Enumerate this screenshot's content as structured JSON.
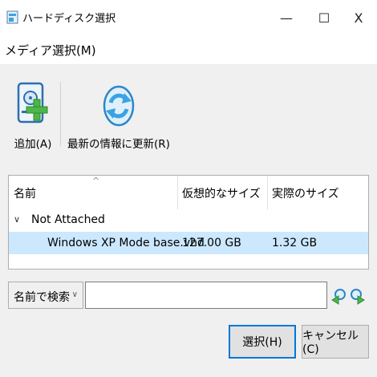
{
  "window": {
    "title": "ハードディスク選択",
    "minimize_glyph": "—",
    "maximize_glyph": "☐",
    "close_glyph": "X"
  },
  "menu": {
    "media_label": "メディア選択(M)"
  },
  "toolbar": {
    "add_label": "追加(A)",
    "add_icon": "hard-disk-add-icon",
    "refresh_label": "最新の情報に更新(R)",
    "refresh_icon": "refresh-icon"
  },
  "list": {
    "columns": [
      "名前",
      "仮想的なサイズ",
      "実際のサイズ"
    ],
    "sort_indicator": "^",
    "groups": [
      {
        "label": "Not Attached",
        "toggle_glyph": "∨",
        "items": [
          {
            "name": "Windows XP Mode base.vhd",
            "virtual_size": "127.00 GB",
            "actual_size": "1.32 GB",
            "selected": true
          }
        ]
      }
    ]
  },
  "search": {
    "mode_label": "名前で検索",
    "mode_chevron": "∨",
    "value": "",
    "placeholder": ""
  },
  "buttons": {
    "choose_label": "選択(H)",
    "cancel_label": "キャンセル(C)"
  },
  "colors": {
    "selection": "#cce8ff",
    "accent": "#0078d7",
    "icon_green": "#4cb648",
    "icon_blue": "#3aa3e3"
  }
}
